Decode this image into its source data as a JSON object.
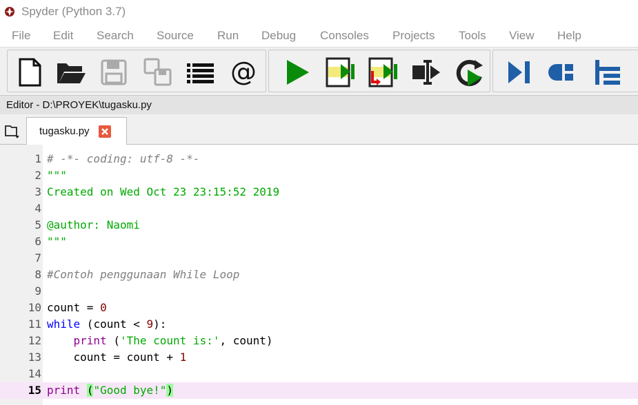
{
  "window": {
    "title": "Spyder (Python 3.7)"
  },
  "menu": [
    {
      "label": "File"
    },
    {
      "label": "Edit"
    },
    {
      "label": "Search"
    },
    {
      "label": "Source"
    },
    {
      "label": "Run"
    },
    {
      "label": "Debug"
    },
    {
      "label": "Consoles"
    },
    {
      "label": "Projects"
    },
    {
      "label": "Tools"
    },
    {
      "label": "View"
    },
    {
      "label": "Help"
    }
  ],
  "toolbar": {
    "buttons": [
      {
        "icon": "new-file-icon"
      },
      {
        "icon": "open-folder-icon"
      },
      {
        "icon": "save-icon"
      },
      {
        "icon": "save-all-icon"
      },
      {
        "icon": "list-icon"
      },
      {
        "icon": "at-sign-icon"
      },
      {
        "icon": "run-icon"
      },
      {
        "icon": "run-cell-icon"
      },
      {
        "icon": "run-cell-advance-icon"
      },
      {
        "icon": "run-selection-icon"
      },
      {
        "icon": "rerun-icon"
      },
      {
        "icon": "debug-icon"
      },
      {
        "icon": "step-icon"
      },
      {
        "icon": "step-into-icon"
      }
    ]
  },
  "editor": {
    "header": "Editor - D:\\PROYEK\\tugasku.py",
    "tab_label": "tugasku.py",
    "current_line": 15,
    "lines": [
      {
        "no": "1",
        "tokens": [
          {
            "t": "# -*- coding: utf-8 -*-",
            "c": "comment"
          }
        ]
      },
      {
        "no": "2",
        "tokens": [
          {
            "t": "\"\"\"",
            "c": "string"
          }
        ]
      },
      {
        "no": "3",
        "tokens": [
          {
            "t": "Created on Wed Oct 23 23:15:52 2019",
            "c": "string"
          }
        ]
      },
      {
        "no": "4",
        "tokens": []
      },
      {
        "no": "5",
        "tokens": [
          {
            "t": "@author: Naomi",
            "c": "string"
          }
        ]
      },
      {
        "no": "6",
        "tokens": [
          {
            "t": "\"\"\"",
            "c": "string"
          }
        ]
      },
      {
        "no": "7",
        "tokens": []
      },
      {
        "no": "8",
        "tokens": [
          {
            "t": "#Contoh penggunaan While Loop",
            "c": "comment"
          }
        ]
      },
      {
        "no": "9",
        "tokens": []
      },
      {
        "no": "10",
        "tokens": [
          {
            "t": "count = ",
            "c": "plain"
          },
          {
            "t": "0",
            "c": "number"
          }
        ]
      },
      {
        "no": "11",
        "tokens": [
          {
            "t": "while",
            "c": "keyword"
          },
          {
            "t": " (count < ",
            "c": "plain"
          },
          {
            "t": "9",
            "c": "number"
          },
          {
            "t": "):",
            "c": "plain"
          }
        ]
      },
      {
        "no": "12",
        "tokens": [
          {
            "t": "    ",
            "c": "plain"
          },
          {
            "t": "print",
            "c": "builtin"
          },
          {
            "t": " (",
            "c": "plain"
          },
          {
            "t": "'The count is:'",
            "c": "string"
          },
          {
            "t": ", count)",
            "c": "plain"
          }
        ]
      },
      {
        "no": "13",
        "tokens": [
          {
            "t": "    count = count + ",
            "c": "plain"
          },
          {
            "t": "1",
            "c": "number"
          }
        ]
      },
      {
        "no": "14",
        "tokens": []
      },
      {
        "no": "15",
        "tokens": [
          {
            "t": "print",
            "c": "builtin"
          },
          {
            "t": " ",
            "c": "plain"
          },
          {
            "t": "(",
            "c": "paren-match"
          },
          {
            "t": "\"Good bye!\"",
            "c": "string"
          },
          {
            "t": ")",
            "c": "paren-match"
          }
        ]
      }
    ]
  }
}
